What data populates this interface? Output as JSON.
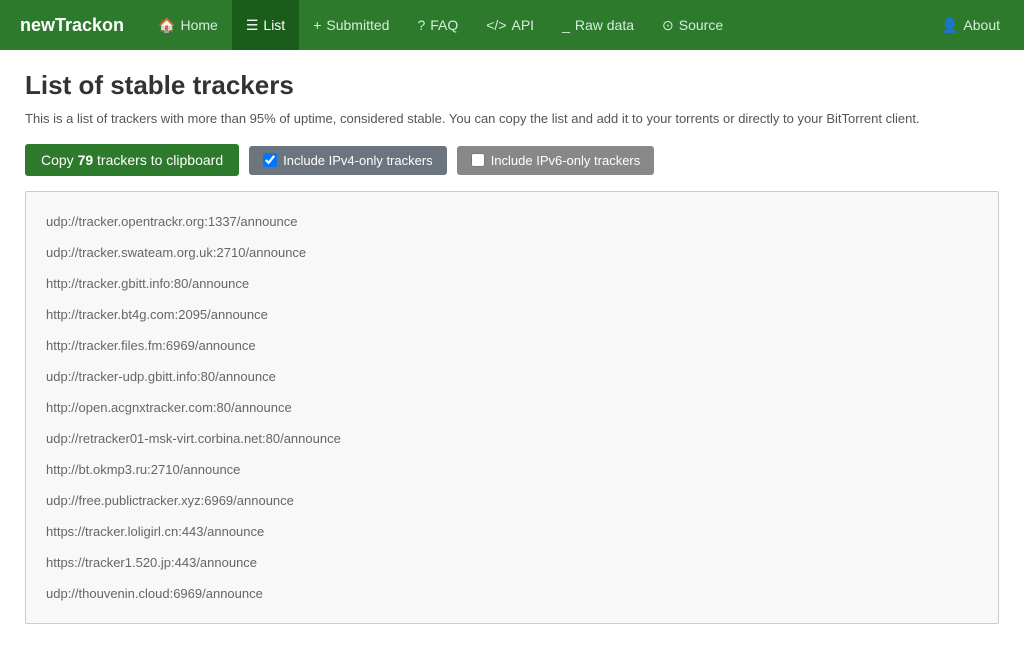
{
  "brand": "newTrackon",
  "nav": {
    "items": [
      {
        "id": "home",
        "label": "Home",
        "icon": "🏠",
        "active": false
      },
      {
        "id": "list",
        "label": "List",
        "icon": "≡",
        "active": true
      },
      {
        "id": "submitted",
        "label": "Submitted",
        "icon": "+",
        "active": false
      },
      {
        "id": "faq",
        "label": "FAQ",
        "icon": "?",
        "active": false
      },
      {
        "id": "api",
        "label": "API",
        "icon": "</>",
        "active": false
      },
      {
        "id": "rawdata",
        "label": "Raw data",
        "icon": "_",
        "active": false
      },
      {
        "id": "source",
        "label": "Source",
        "icon": "◎",
        "active": false
      }
    ],
    "right_item": {
      "id": "about",
      "label": "About",
      "icon": "👤"
    }
  },
  "page": {
    "title": "List of stable trackers",
    "description": "This is a list of trackers with more than 95% of uptime, considered stable. You can copy the list and add it to your torrents or directly to your BitTorrent client."
  },
  "controls": {
    "copy_button_prefix": "Copy ",
    "copy_count": "79",
    "copy_button_suffix": " trackers to clipboard",
    "ipv4_label": "Include IPv4-only trackers",
    "ipv4_checked": true,
    "ipv6_label": "Include IPv6-only trackers",
    "ipv6_checked": false
  },
  "trackers": [
    "udp://tracker.opentrackr.org:1337/announce",
    "udp://tracker.swateam.org.uk:2710/announce",
    "http://tracker.gbitt.info:80/announce",
    "http://tracker.bt4g.com:2095/announce",
    "http://tracker.files.fm:6969/announce",
    "udp://tracker-udp.gbitt.info:80/announce",
    "http://open.acgnxtracker.com:80/announce",
    "udp://retracker01-msk-virt.corbina.net:80/announce",
    "http://bt.okmp3.ru:2710/announce",
    "udp://free.publictracker.xyz:6969/announce",
    "https://tracker.loligirl.cn:443/announce",
    "https://tracker1.520.jp:443/announce",
    "udp://thouvenin.cloud:6969/announce"
  ]
}
